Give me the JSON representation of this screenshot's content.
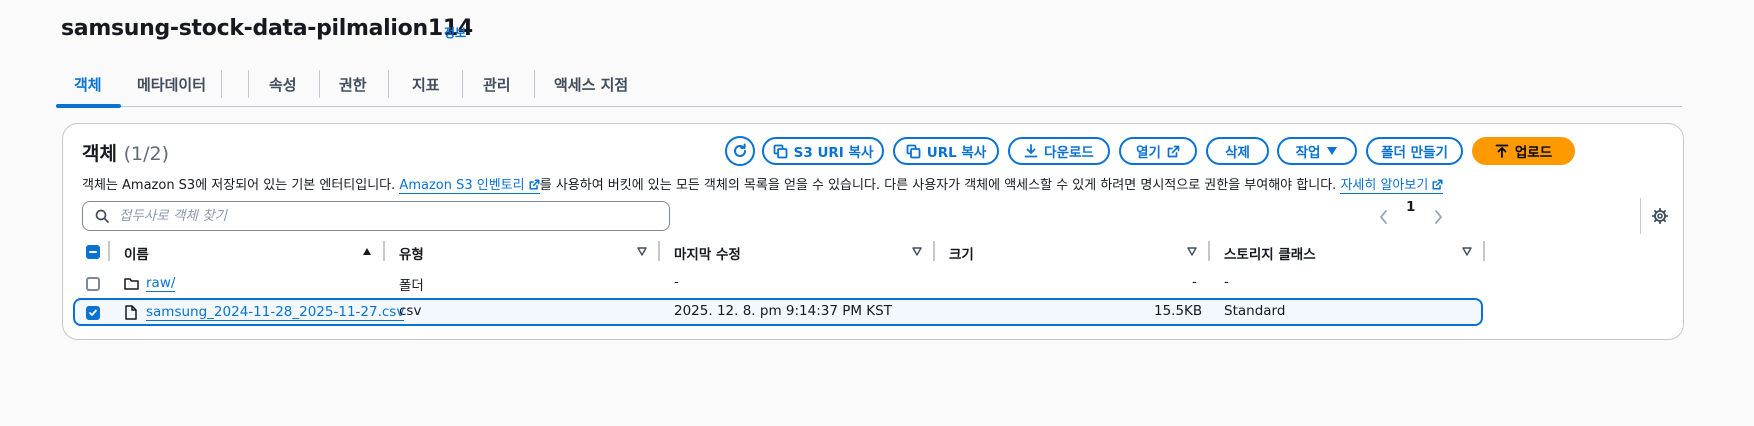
{
  "header": {
    "bucket_name": "samsung-stock-data-pilmalion114",
    "info_label": "정보"
  },
  "tabs": [
    {
      "label": "객체",
      "active": true
    },
    {
      "label": "메타데이터"
    },
    {
      "label": "속성"
    },
    {
      "label": "권한"
    },
    {
      "label": "지표"
    },
    {
      "label": "관리"
    },
    {
      "label": "액세스 지점"
    }
  ],
  "objects_panel": {
    "title": "객체",
    "count": "(1/2)",
    "description_part1": "객체는 Amazon S3에 저장되어 있는 기본 엔터티입니다.",
    "description_link": "Amazon S3 인벤토리",
    "description_part2": "를 사용하여 버킷에 있는 모든 객체의 목록을 얻을 수 있습니다. 다른 사용자가 객체에 액세스할 수 있게 하려면 명시적으로 권한을 부여해야 합니다.",
    "learn_more": "자세히 알아보기",
    "buttons": {
      "copy_s3_uri": "S3 URI 복사",
      "copy_url": "URL 복사",
      "download": "다운로드",
      "open": "열기",
      "delete": "삭제",
      "actions": "작업",
      "create_folder": "폴더 만들기",
      "upload": "업로드"
    },
    "search": {
      "placeholder": "접두사로 객체 찾기"
    },
    "pagination": {
      "current_page": "1"
    }
  },
  "table": {
    "columns": [
      "이름",
      "유형",
      "마지막 수정",
      "크기",
      "스토리지 클래스"
    ],
    "rows": [
      {
        "name": "raw/",
        "type": "폴더",
        "last_modified": "-",
        "size": "-",
        "storage_class": "-",
        "selected": false,
        "icon": "folder-icon"
      },
      {
        "name": "samsung_2024-11-28_2025-11-27.csv",
        "type": "csv",
        "last_modified": "2025. 12. 8. pm 9:14:37 PM KST",
        "size": "15.5KB",
        "storage_class": "Standard",
        "selected": true,
        "icon": "file-icon"
      }
    ]
  },
  "colors": {
    "accent": "#0972d3",
    "primary_button": "#ff9900",
    "border": "#c6c6cd"
  }
}
